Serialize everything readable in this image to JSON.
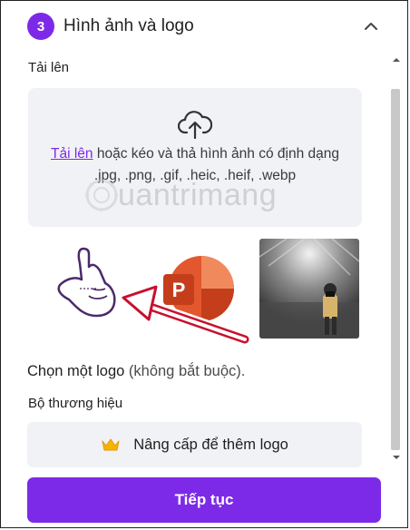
{
  "header": {
    "step_number": "3",
    "title": "Hình ảnh và logo"
  },
  "upload": {
    "label": "Tải lên",
    "link_text": "Tải lên",
    "hint_text": " hoặc kéo và thả hình ảnh có định dạng .jpg, .png, .gif, .heic, .heif, .webp"
  },
  "watermark": {
    "text": "uantrimang"
  },
  "logos": {
    "choose_label": "Chọn một logo",
    "optional_label": " (không bắt buộc)."
  },
  "brand": {
    "label": "Bộ thương hiệu",
    "upgrade_label": "Nâng cấp để thêm logo"
  },
  "footer": {
    "continue_label": "Tiếp tục"
  },
  "colors": {
    "accent": "#7d2ae8",
    "panel": "#f1f2f5",
    "crown": "#f5b400",
    "ppt_red": "#d04423"
  },
  "icons": [
    "chevron-up-icon",
    "cloud-upload-icon",
    "crown-icon",
    "scroll-up-icon",
    "scroll-down-icon"
  ]
}
